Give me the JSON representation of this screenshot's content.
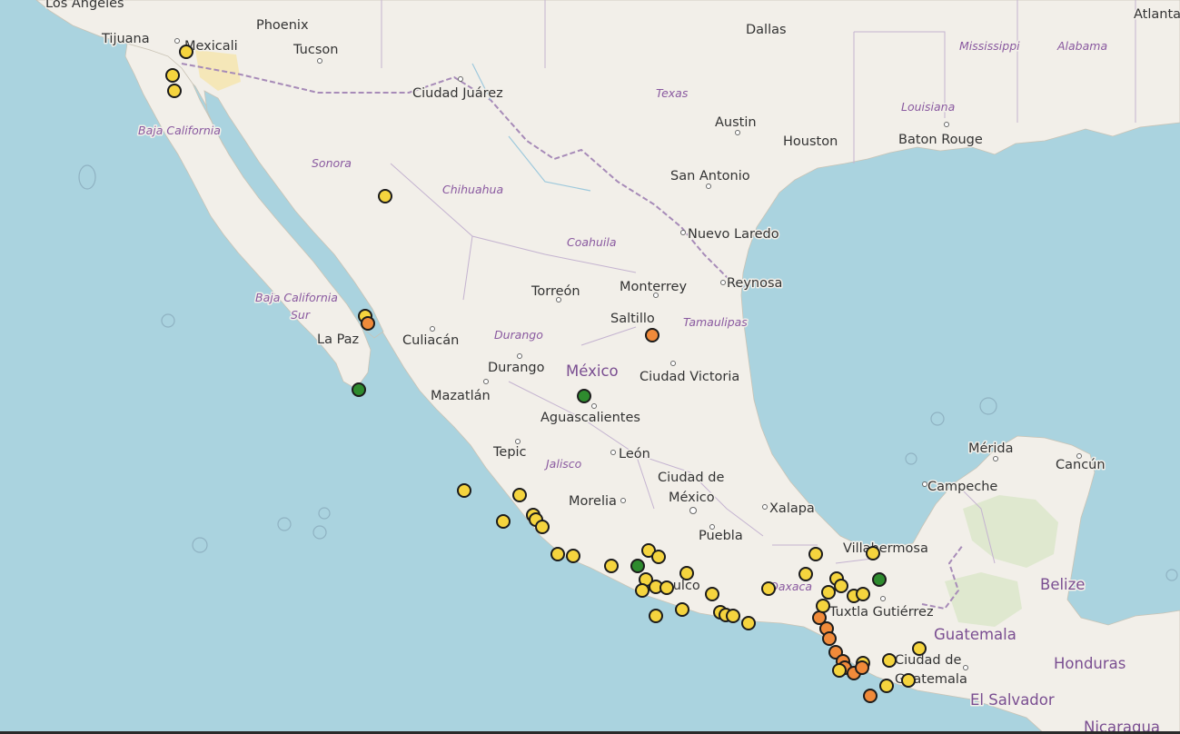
{
  "map": {
    "country_labels": [
      {
        "id": "mexico",
        "text": "México"
      },
      {
        "id": "guatemala",
        "text": "Guatemala"
      },
      {
        "id": "belize",
        "text": "Belize"
      },
      {
        "id": "honduras",
        "text": "Honduras"
      },
      {
        "id": "el-salvador",
        "text": "El Salvador"
      },
      {
        "id": "nicaragua",
        "text": "Nicaragua"
      }
    ],
    "state_labels": [
      {
        "id": "baja-california",
        "text": "Baja California"
      },
      {
        "id": "sonora",
        "text": "Sonora"
      },
      {
        "id": "chihuahua",
        "text": "Chihuahua"
      },
      {
        "id": "coahuila",
        "text": "Coahuila"
      },
      {
        "id": "bcs-1",
        "text": "Baja California"
      },
      {
        "id": "bcs-2",
        "text": "Sur"
      },
      {
        "id": "durango",
        "text": "Durango"
      },
      {
        "id": "tamaulipas",
        "text": "Tamaulipas"
      },
      {
        "id": "jalisco",
        "text": "Jalisco"
      },
      {
        "id": "texas",
        "text": "Texas"
      },
      {
        "id": "louisiana",
        "text": "Louisiana"
      },
      {
        "id": "mississippi",
        "text": "Mississippi"
      },
      {
        "id": "alabama",
        "text": "Alabama"
      },
      {
        "id": "oaxaca",
        "text": "Oaxaca"
      }
    ],
    "city_labels": [
      {
        "id": "los-angeles",
        "text": "Los Angeles"
      },
      {
        "id": "tijuana",
        "text": "Tijuana"
      },
      {
        "id": "mexicali",
        "text": "Mexicali"
      },
      {
        "id": "phoenix",
        "text": "Phoenix"
      },
      {
        "id": "tucson",
        "text": "Tucson"
      },
      {
        "id": "ciudad-juarez",
        "text": "Ciudad Juárez"
      },
      {
        "id": "dallas",
        "text": "Dallas"
      },
      {
        "id": "atlanta",
        "text": "Atlanta"
      },
      {
        "id": "austin",
        "text": "Austin"
      },
      {
        "id": "houston",
        "text": "Houston"
      },
      {
        "id": "baton-rouge",
        "text": "Baton Rouge"
      },
      {
        "id": "san-antonio",
        "text": "San Antonio"
      },
      {
        "id": "nuevo-laredo",
        "text": "Nuevo Laredo"
      },
      {
        "id": "reynosa",
        "text": "Reynosa"
      },
      {
        "id": "monterrey",
        "text": "Monterrey"
      },
      {
        "id": "torreon",
        "text": "Torreón"
      },
      {
        "id": "saltillo",
        "text": "Saltillo"
      },
      {
        "id": "la-paz",
        "text": "La Paz"
      },
      {
        "id": "culiacan",
        "text": "Culiacán"
      },
      {
        "id": "durango-city",
        "text": "Durango"
      },
      {
        "id": "ciudad-victoria",
        "text": "Ciudad Victoria"
      },
      {
        "id": "mazatlan",
        "text": "Mazatlán"
      },
      {
        "id": "aguascalientes",
        "text": "Aguascalientes"
      },
      {
        "id": "tepic",
        "text": "Tepic"
      },
      {
        "id": "leon",
        "text": "León"
      },
      {
        "id": "merida",
        "text": "Mérida"
      },
      {
        "id": "cancun",
        "text": "Cancún"
      },
      {
        "id": "campeche",
        "text": "Campeche"
      },
      {
        "id": "cdmx-1",
        "text": "Ciudad de"
      },
      {
        "id": "cdmx-2",
        "text": "México"
      },
      {
        "id": "morelia",
        "text": "Morelia"
      },
      {
        "id": "xalapa",
        "text": "Xalapa"
      },
      {
        "id": "puebla",
        "text": "Puebla"
      },
      {
        "id": "villahermosa",
        "text": "Villahermosa"
      },
      {
        "id": "acapulco",
        "text": "Acapulco"
      },
      {
        "id": "tuxtla",
        "text": "Tuxtla Gutiérrez"
      },
      {
        "id": "guatemala-city-1",
        "text": "Ciudad de"
      },
      {
        "id": "guatemala-city-2",
        "text": "Guatemala"
      }
    ],
    "marker_colors": {
      "yellow": "#f5d43e",
      "orange": "#f08a3a",
      "green": "#2e8b2e"
    },
    "water_color": "#aad3df",
    "land_color": "#f2efe9",
    "markers": [
      {
        "c": "yellow"
      },
      {
        "c": "yellow"
      },
      {
        "c": "yellow"
      },
      {
        "c": "yellow"
      },
      {
        "c": "yellow"
      },
      {
        "c": "orange"
      },
      {
        "c": "green"
      },
      {
        "c": "orange"
      },
      {
        "c": "green"
      },
      {
        "c": "yellow"
      },
      {
        "c": "yellow"
      },
      {
        "c": "yellow"
      },
      {
        "c": "yellow"
      },
      {
        "c": "yellow"
      },
      {
        "c": "yellow"
      },
      {
        "c": "yellow"
      },
      {
        "c": "yellow"
      },
      {
        "c": "yellow"
      },
      {
        "c": "yellow"
      },
      {
        "c": "yellow"
      },
      {
        "c": "green"
      },
      {
        "c": "yellow"
      },
      {
        "c": "yellow"
      },
      {
        "c": "yellow"
      },
      {
        "c": "yellow"
      },
      {
        "c": "yellow"
      },
      {
        "c": "yellow"
      },
      {
        "c": "yellow"
      },
      {
        "c": "yellow"
      },
      {
        "c": "yellow"
      },
      {
        "c": "yellow"
      },
      {
        "c": "yellow"
      },
      {
        "c": "yellow"
      },
      {
        "c": "yellow"
      },
      {
        "c": "yellow"
      },
      {
        "c": "yellow"
      },
      {
        "c": "yellow"
      },
      {
        "c": "yellow"
      },
      {
        "c": "yellow"
      },
      {
        "c": "yellow"
      },
      {
        "c": "yellow"
      },
      {
        "c": "green"
      },
      {
        "c": "orange"
      },
      {
        "c": "orange"
      },
      {
        "c": "orange"
      },
      {
        "c": "orange"
      },
      {
        "c": "orange"
      },
      {
        "c": "orange"
      },
      {
        "c": "yellow"
      },
      {
        "c": "yellow"
      },
      {
        "c": "orange"
      },
      {
        "c": "orange"
      },
      {
        "c": "yellow"
      },
      {
        "c": "yellow"
      },
      {
        "c": "orange"
      },
      {
        "c": "yellow"
      },
      {
        "c": "yellow"
      },
      {
        "c": "yellow"
      },
      {
        "c": "yellow"
      }
    ]
  }
}
